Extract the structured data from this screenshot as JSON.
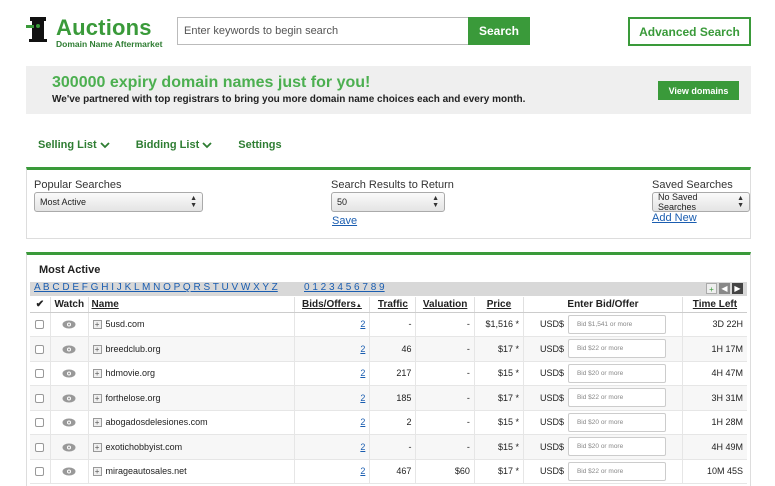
{
  "header": {
    "logo_title": "Auctions",
    "logo_subtitle": "Domain Name Aftermarket",
    "search_placeholder": "Enter keywords to begin search",
    "search_button": "Search",
    "advanced_button": "Advanced Search"
  },
  "banner": {
    "title": "300000 expiry domain names just for you!",
    "text": "We've partnered with top registrars to bring you more domain name choices each and every month.",
    "button": "View domains"
  },
  "nav": {
    "items": [
      {
        "label": "Selling List",
        "icon": "chevron-down-icon"
      },
      {
        "label": "Bidding List",
        "icon": "chevron-down-icon"
      },
      {
        "label": "Settings",
        "icon": ""
      }
    ]
  },
  "filters": {
    "popular_label": "Popular Searches",
    "popular_value": "Most Active",
    "results_label": "Search Results to Return",
    "results_value": "50",
    "save_link": "Save",
    "saved_label": "Saved Searches",
    "saved_value": "No Saved Searches",
    "add_new_link": "Add New"
  },
  "results": {
    "title": "Most Active",
    "alphabet": "A B C D E F G H I J K L M N O P Q R S T U V W X Y Z",
    "digits": "0 1 2 3 4 5 6 7 8 9",
    "columns": {
      "check": "✔",
      "watch": "Watch",
      "name": "Name",
      "bids": "Bids/Offers",
      "traffic": "Traffic",
      "valuation": "Valuation",
      "price": "Price",
      "bid": "Enter Bid/Offer",
      "time": "Time Left"
    },
    "currency": "USD$",
    "rows": [
      {
        "name": "5usd.com",
        "bids": "2",
        "traffic": "-",
        "valuation": "-",
        "price": "$1,516 *",
        "bid_placeholder": "Bid $1,541 or more",
        "time": "3D 22H"
      },
      {
        "name": "breedclub.org",
        "bids": "2",
        "traffic": "46",
        "valuation": "-",
        "price": "$17 *",
        "bid_placeholder": "Bid $22 or more",
        "time": "1H 17M"
      },
      {
        "name": "hdmovie.org",
        "bids": "2",
        "traffic": "217",
        "valuation": "-",
        "price": "$15 *",
        "bid_placeholder": "Bid $20 or more",
        "time": "4H 47M"
      },
      {
        "name": "forthelose.org",
        "bids": "2",
        "traffic": "185",
        "valuation": "-",
        "price": "$17 *",
        "bid_placeholder": "Bid $22 or more",
        "time": "3H 31M"
      },
      {
        "name": "abogadosdelesiones.com",
        "bids": "2",
        "traffic": "2",
        "valuation": "-",
        "price": "$15 *",
        "bid_placeholder": "Bid $20 or more",
        "time": "1H 28M"
      },
      {
        "name": "exotichobbyist.com",
        "bids": "2",
        "traffic": "-",
        "valuation": "-",
        "price": "$15 *",
        "bid_placeholder": "Bid $20 or more",
        "time": "4H 49M"
      },
      {
        "name": "mirageautosales.net",
        "bids": "2",
        "traffic": "467",
        "valuation": "$60",
        "price": "$17 *",
        "bid_placeholder": "Bid $22 or more",
        "time": "10M 45S"
      }
    ]
  },
  "colors": {
    "brand_green": "#3a9a3a",
    "link_blue": "#1a5db0"
  }
}
